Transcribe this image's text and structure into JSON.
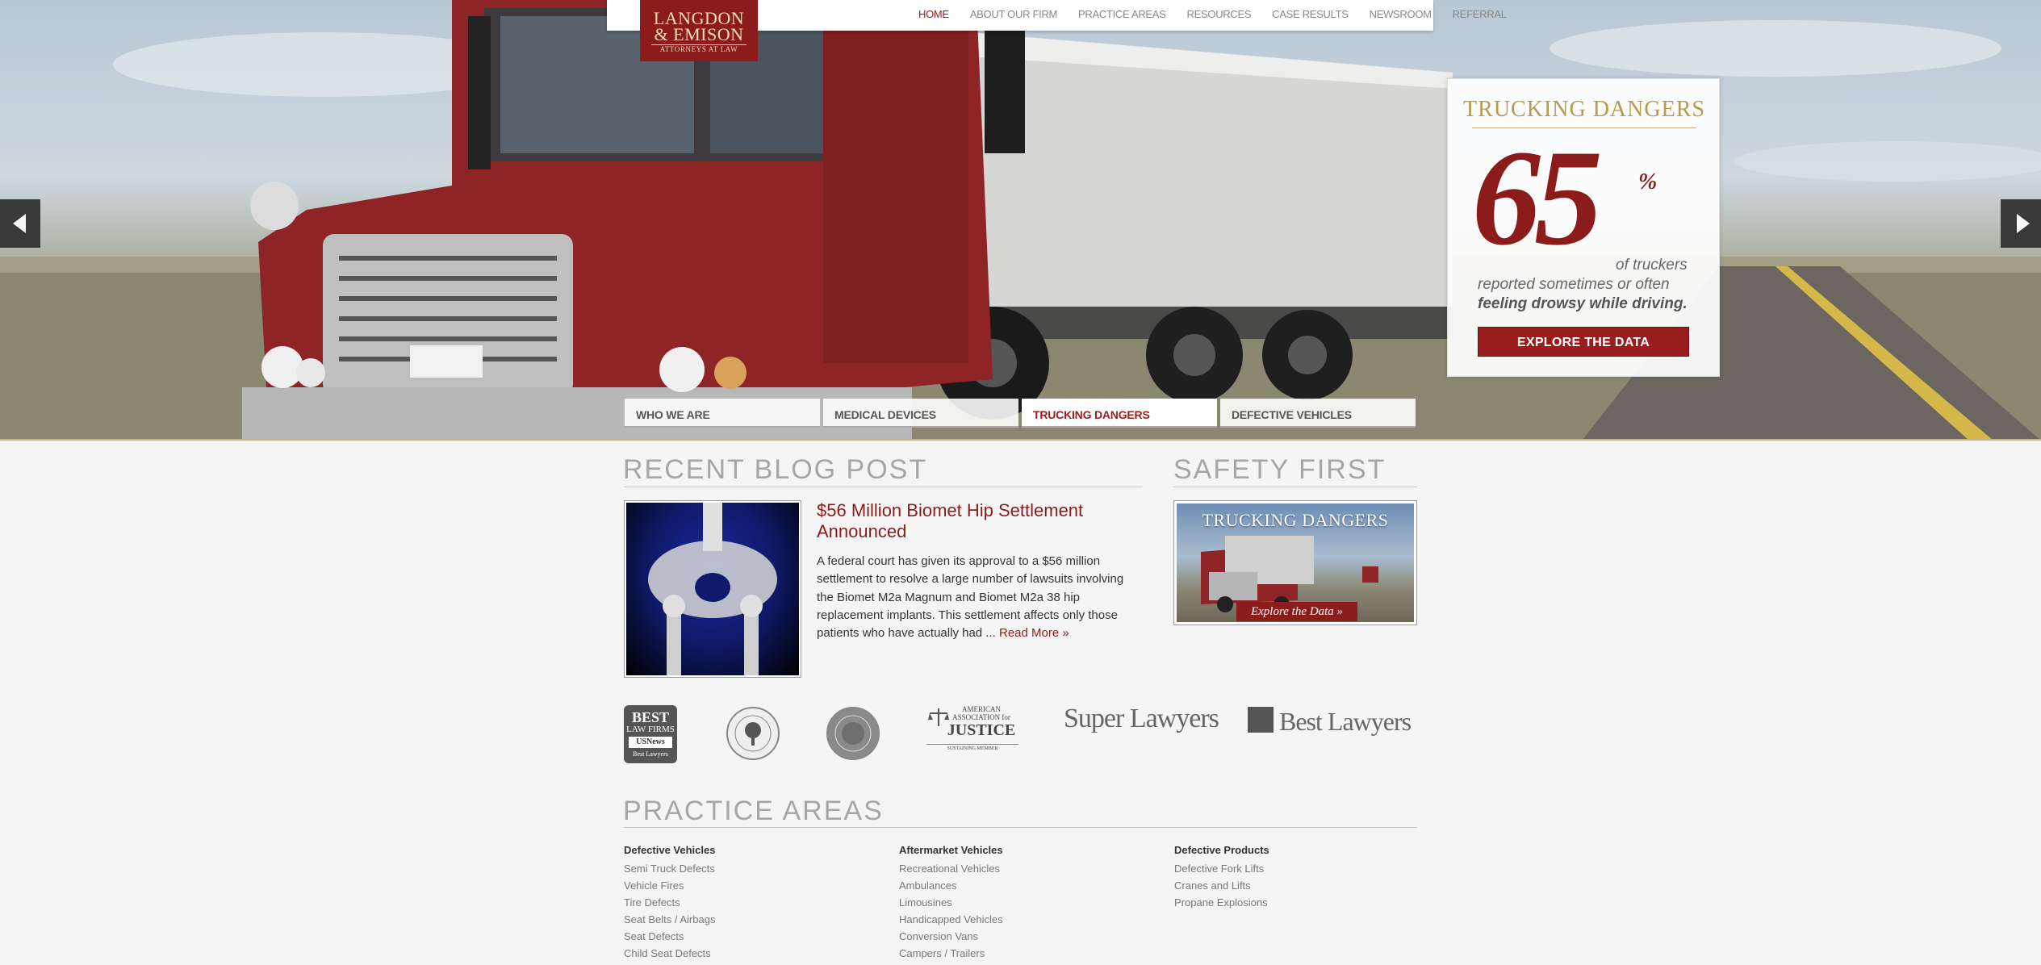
{
  "logo": {
    "line1": "LANGDON",
    "line2": "& EMISON",
    "line3": "ATTORNEYS AT LAW"
  },
  "nav": {
    "items": [
      "HOME",
      "ABOUT OUR FIRM",
      "PRACTICE AREAS",
      "RESOURCES",
      "CASE RESULTS",
      "NEWSROOM",
      "REFERRAL"
    ],
    "active": "HOME"
  },
  "promo": {
    "title": "TRUCKING DANGERS",
    "stat": "65",
    "pct": "%",
    "text1": "of truckers",
    "text2": "reported sometimes or often",
    "text3": "feeling drowsy while driving.",
    "button": "EXPLORE THE DATA"
  },
  "slider_tabs": [
    "WHO WE ARE",
    "MEDICAL DEVICES",
    "TRUCKING DANGERS",
    "DEFECTIVE VEHICLES"
  ],
  "blog": {
    "section_title": "RECENT BLOG POST",
    "post_title": "$56 Million Biomet Hip Settlement Announced",
    "excerpt": "A federal court has given its approval to a $56 million settlement to resolve a large number of lawsuits involving the Biomet M2a Magnum and Biomet M2a 38 hip replacement implants.  This settlement affects only those patients who have actually had ... ",
    "read_more": "Read More »"
  },
  "safety": {
    "section_title": "SAFETY FIRST",
    "image_title": "TRUCKING DANGERS",
    "image_button": "Explore the Data »"
  },
  "badges": {
    "best_law_firms": {
      "line1": "BEST",
      "line2": "LAW FIRMS",
      "line3": "USNews",
      "line4": "Best Lawyers"
    },
    "aaj": {
      "line1": "AMERICAN",
      "line2": "ASSOCIATION for",
      "line3": "JUSTICE",
      "line4": "SUSTAINING MEMBER"
    },
    "super_lawyers": "Super Lawyers",
    "best_lawyers": "Best Lawyers"
  },
  "practice_areas": {
    "section_title": "PRACTICE AREAS",
    "columns": [
      {
        "heading": "Defective Vehicles",
        "items": [
          "Semi Truck Defects",
          "Vehicle Fires",
          "Tire Defects",
          "Seat Belts / Airbags",
          "Seat Defects",
          "Child Seat Defects"
        ]
      },
      {
        "heading": "Aftermarket Vehicles",
        "items": [
          "Recreational Vehicles",
          "Ambulances",
          "Limousines",
          "Handicapped Vehicles",
          "Conversion Vans",
          "Campers / Trailers"
        ]
      },
      {
        "heading": "Defective Products",
        "items": [
          "Defective Fork Lifts",
          "Cranes and Lifts",
          "Propane Explosions"
        ]
      }
    ]
  },
  "colors": {
    "brand_red": "#8c1c1c",
    "gold": "#b89a4e",
    "heading_gray": "#a6a6a6"
  }
}
